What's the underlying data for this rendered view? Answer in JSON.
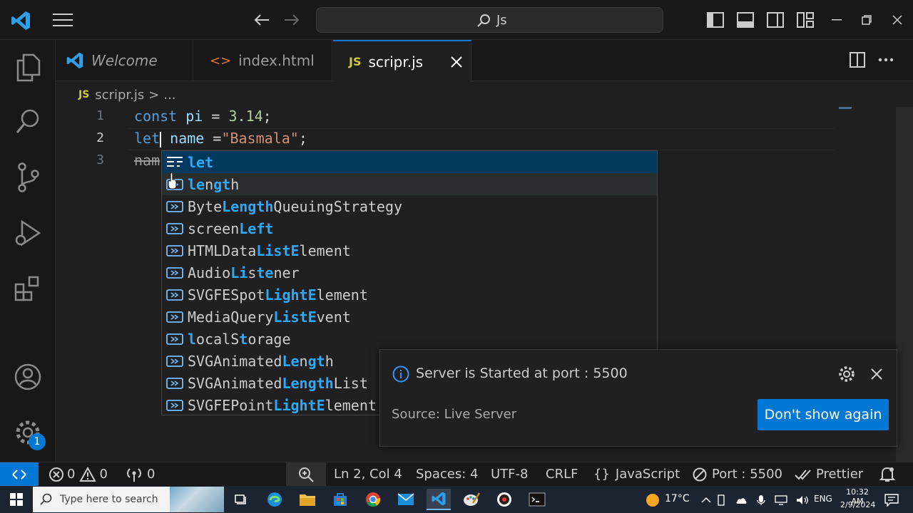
{
  "titlebar": {
    "search_text": "Js"
  },
  "tabs": [
    {
      "label": "Welcome"
    },
    {
      "label": "index.html"
    },
    {
      "label": "scripr.js"
    }
  ],
  "breadcrumb": {
    "file": "scripr.js",
    "sep": ">",
    "more": "..."
  },
  "editor": {
    "line_numbers": [
      "1",
      "2",
      "3"
    ],
    "line1": {
      "kw": "const",
      "name": "pi",
      "op": " = ",
      "value": "3.14",
      "end": ";"
    },
    "line2": {
      "kw": "let",
      "name": " name",
      "op": " =",
      "value": "\"Basmala\"",
      "end": ";"
    },
    "line3": {
      "text": "nam"
    }
  },
  "suggest": {
    "items": [
      {
        "pre": "",
        "m1": "let",
        "mid": "",
        "m2": "",
        "post": "",
        "kind": "snippet-icon"
      },
      {
        "pre": "",
        "m1": "le",
        "mid": "n",
        "m2": "gt",
        "post": "h",
        "kind": "variable-icon"
      },
      {
        "pre": "Byte",
        "m1": "Length",
        "mid": "QueuingStrategy",
        "m2": "",
        "post": "",
        "kind": "variable-icon"
      },
      {
        "pre": "screen",
        "m1": "Left",
        "mid": "",
        "m2": "",
        "post": "",
        "kind": "variable-icon"
      },
      {
        "pre": "HTMLData",
        "m1": "List",
        "mid": "",
        "m2": "E",
        "post": "lement",
        "kind": "variable-icon"
      },
      {
        "pre": "Audio",
        "m1": "Li",
        "mid": "s",
        "m2": "te",
        "post": "ner",
        "kind": "variable-icon"
      },
      {
        "pre": "SVGFESpot",
        "m1": "Light",
        "mid": "",
        "m2": "E",
        "post": "lement",
        "kind": "variable-icon"
      },
      {
        "pre": "MediaQuery",
        "m1": "List",
        "mid": "",
        "m2": "E",
        "post": "vent",
        "kind": "variable-icon"
      },
      {
        "pre": "",
        "m1": "l",
        "mid": "ocalS",
        "m2": "t",
        "post": "orage",
        "kind": "variable-icon"
      },
      {
        "pre": "SVGAnimated",
        "m1": "Le",
        "mid": "n",
        "m2": "gt",
        "post": "h",
        "kind": "variable-icon"
      },
      {
        "pre": "SVGAnimated",
        "m1": "Length",
        "mid": "",
        "m2": "",
        "post": "List",
        "kind": "variable-icon"
      },
      {
        "pre": "SVGFEPoint",
        "m1": "Light",
        "mid": "",
        "m2": "E",
        "post": "lement",
        "kind": "variable-icon"
      }
    ]
  },
  "notification": {
    "message": "Server is Started at port : 5500",
    "source": "Source: Live Server",
    "button": "Don't show again"
  },
  "statusbar": {
    "errors": "0",
    "warnings": "0",
    "ports": "0",
    "position": "Ln 2, Col 4",
    "spaces": "Spaces: 4",
    "encoding": "UTF-8",
    "eol": "CRLF",
    "language": "JavaScript",
    "port": "Port : 5500",
    "prettier": "Prettier"
  },
  "activity": {
    "badge": "1"
  },
  "taskbar": {
    "search_placeholder": "Type here to search",
    "weather": "17°C",
    "lang": "ENG",
    "time": "10:32 AM",
    "date": "2/9/2024"
  },
  "colors": {
    "accent": "#0078d4",
    "match": "#2aaaff",
    "selection": "#04395e"
  }
}
